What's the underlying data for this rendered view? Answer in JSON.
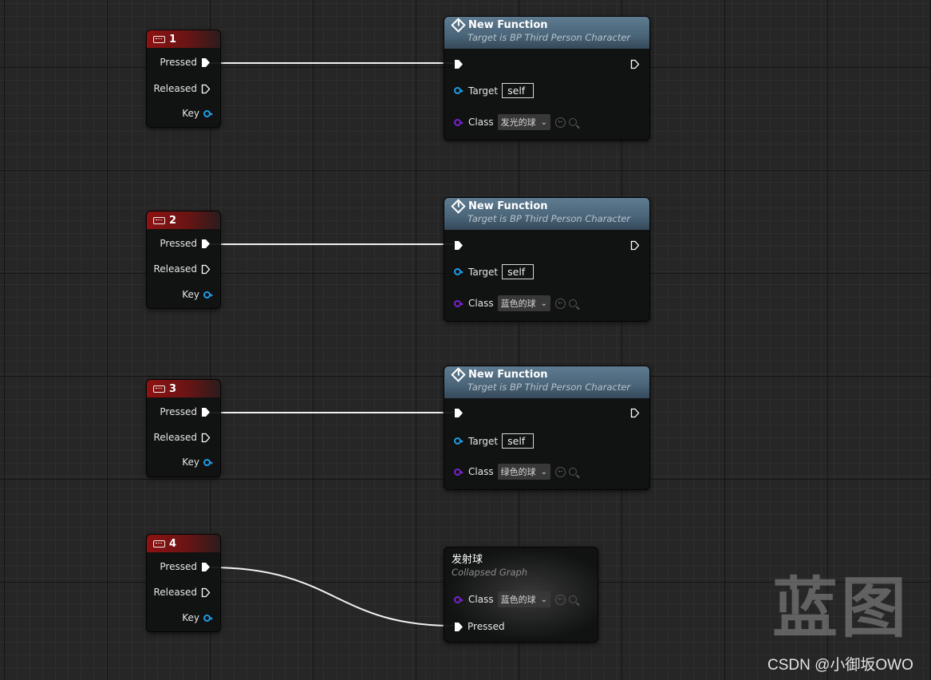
{
  "events": [
    {
      "key": "1",
      "pressed": "Pressed",
      "released": "Released",
      "key_label": "Key"
    },
    {
      "key": "2",
      "pressed": "Pressed",
      "released": "Released",
      "key_label": "Key"
    },
    {
      "key": "3",
      "pressed": "Pressed",
      "released": "Released",
      "key_label": "Key"
    },
    {
      "key": "4",
      "pressed": "Pressed",
      "released": "Released",
      "key_label": "Key"
    }
  ],
  "functions": [
    {
      "title": "New Function",
      "subtitle": "Target is BP Third Person Character",
      "target_label": "Target",
      "target_value": "self",
      "class_label": "Class",
      "class_value": "发光的球"
    },
    {
      "title": "New Function",
      "subtitle": "Target is BP Third Person Character",
      "target_label": "Target",
      "target_value": "self",
      "class_label": "Class",
      "class_value": "蓝色的球"
    },
    {
      "title": "New Function",
      "subtitle": "Target is BP Third Person Character",
      "target_label": "Target",
      "target_value": "self",
      "class_label": "Class",
      "class_value": "绿色的球"
    }
  ],
  "collapsed": {
    "title": "发射球",
    "subtitle": "Collapsed Graph",
    "class_label": "Class",
    "class_value": "蓝色的球",
    "pressed_label": "Pressed"
  },
  "watermark": {
    "logo": "蓝图",
    "credit": "CSDN @小御坂OWO"
  },
  "colors": {
    "event_header": "#8e1212",
    "function_header": "#4a6478",
    "object_pin": "#1e9de8",
    "class_pin": "#7a22d0",
    "exec_wire": "#ffffff"
  },
  "icons": {
    "event": "keyboard-icon",
    "function": "function-icon",
    "exec": "exec-pin-icon",
    "data": "data-pin-icon",
    "reset": "reset-arrow-icon",
    "browse": "search-icon",
    "dropdown": "chevron-down-icon"
  }
}
